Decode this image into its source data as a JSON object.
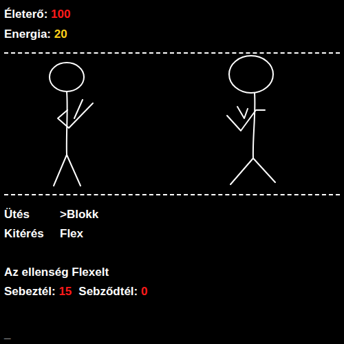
{
  "stats": [
    {
      "label": "Életerő:",
      "value": "100",
      "color": "#ff1a1a"
    },
    {
      "label": "Energia:",
      "value": "20",
      "color": "#ffd21a"
    }
  ],
  "menu": {
    "cursor": ">",
    "items": [
      {
        "label": "Ütés",
        "selected": false
      },
      {
        "label": "Blokk",
        "selected": true
      },
      {
        "label": "Kitérés",
        "selected": false
      },
      {
        "label": "Flex",
        "selected": false
      }
    ]
  },
  "message": "Az ellenség Flexelt",
  "results": [
    {
      "label": "Sebeztél:",
      "value": "15",
      "color": "#ff1a1a"
    },
    {
      "label": "Sebződtél:",
      "value": "0",
      "color": "#ff1a1a"
    }
  ],
  "prompt": "_"
}
